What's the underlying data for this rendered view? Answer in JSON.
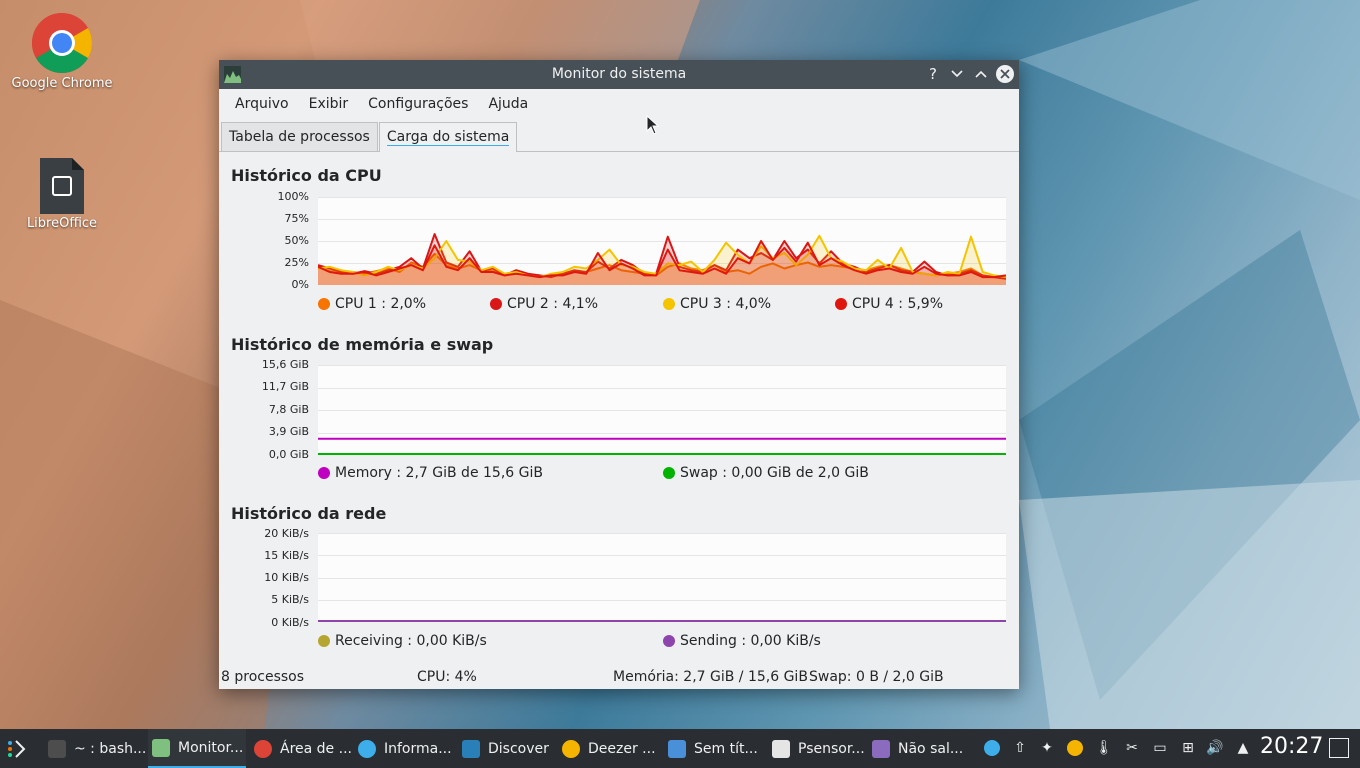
{
  "desktop": {
    "icons": [
      {
        "label": "Google Chrome"
      },
      {
        "label": "LibreOffice"
      }
    ]
  },
  "window": {
    "title": "Monitor do sistema",
    "menu": [
      "Arquivo",
      "Exibir",
      "Configurações",
      "Ajuda"
    ],
    "tabs": [
      {
        "label": "Tabela de processos",
        "active": false
      },
      {
        "label": "Carga do sistema",
        "active": true
      }
    ],
    "cpu": {
      "title": "Histórico da CPU",
      "yticks": [
        "100%",
        "75%",
        "50%",
        "25%",
        "0%"
      ],
      "legend": [
        {
          "label": "CPU 1 : 2,0%",
          "color": "#f67400"
        },
        {
          "label": "CPU 2 : 4,1%",
          "color": "#da1616"
        },
        {
          "label": "CPU 3 : 4,0%",
          "color": "#f5c400"
        },
        {
          "label": "CPU 4 : 5,9%",
          "color": "#e0170e"
        }
      ]
    },
    "memory": {
      "title": "Histórico de memória e swap",
      "yticks": [
        "15,6 GiB",
        "11,7 GiB",
        "7,8 GiB",
        "3,9 GiB",
        "0,0 GiB"
      ],
      "legend": [
        {
          "label": "Memory : 2,7 GiB de 15,6 GiB",
          "color": "#c000c0"
        },
        {
          "label": "Swap : 0,00 GiB de 2,0 GiB",
          "color": "#00b300"
        }
      ]
    },
    "network": {
      "title": "Histórico da rede",
      "yticks": [
        "20 KiB/s",
        "15 KiB/s",
        "10 KiB/s",
        "5 KiB/s",
        "0 KiB/s"
      ],
      "legend": [
        {
          "label": "Receiving : 0,00 KiB/s",
          "color": "#b5a531"
        },
        {
          "label": "Sending : 0,00 KiB/s",
          "color": "#8e44ad"
        }
      ]
    },
    "status": {
      "processes": "8 processos",
      "cpu": "CPU: 4%",
      "memory": "Memória: 2,7 GiB / 15,6 GiB",
      "swap": "Swap: 0 B / 2,0 GiB"
    }
  },
  "chart_data": [
    {
      "type": "line",
      "title": "Histórico da CPU",
      "ylim": [
        0,
        100
      ],
      "x": [
        0,
        1,
        2,
        3,
        4,
        5,
        6,
        7,
        8,
        9,
        10,
        11,
        12,
        13,
        14,
        15,
        16,
        17,
        18,
        19,
        20,
        21,
        22,
        23,
        24,
        25,
        26,
        27,
        28,
        29,
        30,
        31,
        32,
        33,
        34,
        35,
        36,
        37,
        38,
        39,
        40,
        41,
        42,
        43,
        44,
        45,
        46,
        47,
        48,
        49,
        50,
        51,
        52,
        53,
        54,
        55,
        56,
        57,
        58,
        59
      ],
      "series": [
        {
          "name": "CPU 1 : 2,0%",
          "values": [
            20,
            15,
            12,
            14,
            12,
            15,
            18,
            14,
            25,
            20,
            35,
            22,
            18,
            22,
            16,
            15,
            12,
            14,
            10,
            9,
            10,
            12,
            15,
            14,
            18,
            22,
            16,
            14,
            12,
            10,
            20,
            24,
            18,
            16,
            22,
            14,
            16,
            12,
            20,
            24,
            18,
            22,
            25,
            20,
            22,
            20,
            18,
            16,
            20,
            22,
            18,
            14,
            12,
            10,
            12,
            14,
            18,
            10,
            8,
            6
          ]
        },
        {
          "name": "CPU 2 : 4,1%",
          "values": [
            22,
            18,
            14,
            12,
            15,
            12,
            16,
            20,
            30,
            18,
            58,
            25,
            20,
            38,
            15,
            18,
            10,
            16,
            12,
            10,
            8,
            12,
            16,
            14,
            26,
            18,
            28,
            22,
            12,
            12,
            55,
            20,
            16,
            14,
            22,
            16,
            40,
            30,
            36,
            28,
            50,
            30,
            40,
            24,
            38,
            24,
            20,
            14,
            18,
            22,
            16,
            14,
            26,
            14,
            10,
            12,
            16,
            10,
            8,
            6
          ]
        },
        {
          "name": "CPU 3 : 4,0%",
          "values": [
            18,
            20,
            16,
            14,
            10,
            14,
            20,
            16,
            22,
            18,
            30,
            50,
            28,
            26,
            16,
            20,
            12,
            14,
            10,
            8,
            12,
            14,
            20,
            18,
            28,
            40,
            22,
            20,
            14,
            12,
            24,
            22,
            26,
            14,
            28,
            48,
            34,
            24,
            44,
            30,
            36,
            22,
            34,
            56,
            30,
            26,
            18,
            16,
            28,
            18,
            42,
            14,
            12,
            10,
            14,
            12,
            55,
            14,
            10,
            8
          ]
        },
        {
          "name": "CPU 4 : 5,9%",
          "values": [
            20,
            14,
            12,
            12,
            14,
            10,
            14,
            18,
            22,
            16,
            45,
            20,
            16,
            30,
            14,
            14,
            10,
            12,
            10,
            8,
            10,
            10,
            14,
            12,
            36,
            16,
            24,
            18,
            10,
            10,
            40,
            16,
            14,
            12,
            18,
            12,
            30,
            24,
            50,
            28,
            42,
            26,
            48,
            22,
            30,
            22,
            16,
            12,
            16,
            18,
            14,
            12,
            20,
            12,
            10,
            10,
            14,
            8,
            8,
            10
          ]
        }
      ]
    },
    {
      "type": "line",
      "title": "Histórico de memória e swap",
      "ylim": [
        0,
        15.6
      ],
      "series": [
        {
          "name": "Memory : 2,7 GiB de 15,6 GiB",
          "values": [
            2.7,
            2.7
          ]
        },
        {
          "name": "Swap : 0,00 GiB de 2,0 GiB",
          "values": [
            0,
            0
          ]
        }
      ]
    },
    {
      "type": "line",
      "title": "Histórico da rede",
      "ylim": [
        0,
        20
      ],
      "series": [
        {
          "name": "Receiving : 0,00 KiB/s",
          "values": [
            0,
            0
          ]
        },
        {
          "name": "Sending : 0,00 KiB/s",
          "values": [
            0,
            0
          ]
        }
      ]
    }
  ],
  "taskbar": {
    "tasks": [
      {
        "label": "~ : bash...",
        "icon": "terminal-icon",
        "color": "#4d4d4d"
      },
      {
        "label": "Monitor...",
        "icon": "system-monitor-icon",
        "color": "#7fbf7f",
        "active": true
      },
      {
        "label": "Área de ...",
        "icon": "chrome-icon",
        "color": "#db4437"
      },
      {
        "label": "Informa...",
        "icon": "info-icon",
        "color": "#3daee9"
      },
      {
        "label": "Discover",
        "icon": "discover-icon",
        "color": "#2980b9"
      },
      {
        "label": "Deezer ...",
        "icon": "deezer-icon",
        "color": "#f5b400"
      },
      {
        "label": "Sem tít...",
        "icon": "document-icon",
        "color": "#4a90d9"
      },
      {
        "label": "Psensor...",
        "icon": "thermometer-icon",
        "color": "#e5e5e5"
      },
      {
        "label": "Não sal...",
        "icon": "image-editor-icon",
        "color": "#8a6bbe"
      }
    ],
    "clock": "20:27"
  }
}
